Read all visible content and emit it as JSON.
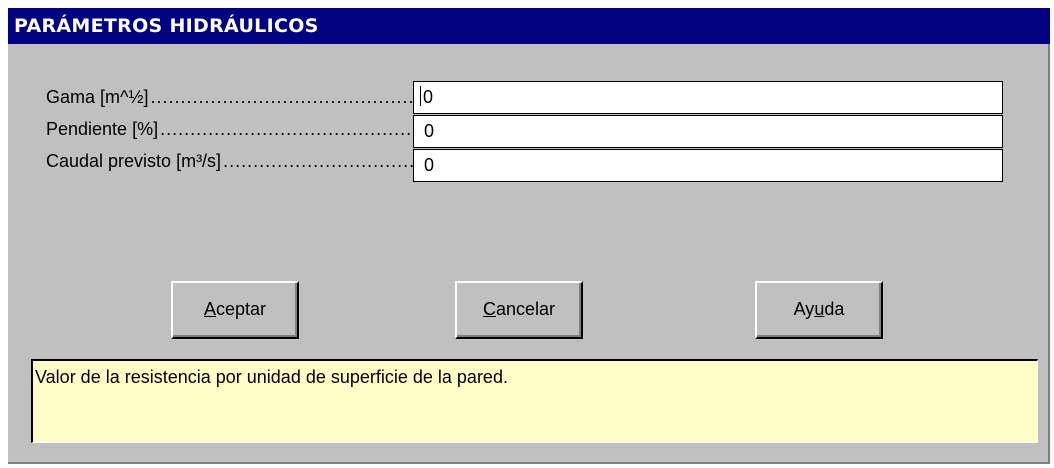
{
  "window": {
    "title": "PARÁMETROS HIDRÁULICOS"
  },
  "fields": [
    {
      "label": "Gama [m^½]",
      "value": "0"
    },
    {
      "label": "Pendiente [%]",
      "value": "0"
    },
    {
      "label": "Caudal previsto [m³/s]",
      "value": "0"
    }
  ],
  "buttons": {
    "accept": {
      "first": "A",
      "rest": "ceptar"
    },
    "cancel": {
      "first": "C",
      "rest": "ancelar"
    },
    "help": {
      "before": "Ay",
      "underlined": "u",
      "after": "da"
    }
  },
  "help_text": "Valor de la resistencia por unidad de superficie de la pared.",
  "colors": {
    "titlebar": "#000080",
    "dialog_bg": "#c0c0c0",
    "help_bg": "#ffffc8"
  }
}
